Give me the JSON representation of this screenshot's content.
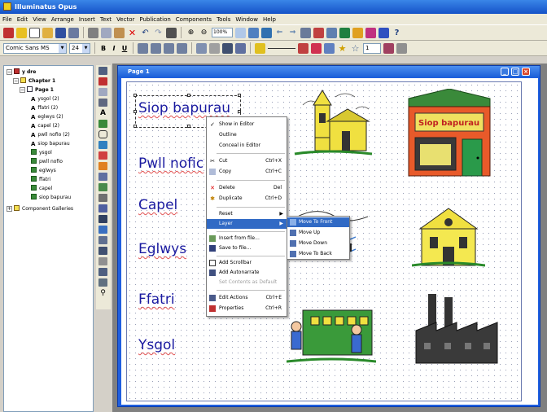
{
  "app": {
    "title": "Illuminatus Opus"
  },
  "menubar": [
    "File",
    "Edit",
    "View",
    "Arrange",
    "Insert",
    "Text",
    "Vector",
    "Publication",
    "Components",
    "Tools",
    "Window",
    "Help"
  ],
  "toolbar": {
    "zoom": "100%"
  },
  "format_bar": {
    "font": "Comic Sans MS",
    "size": "24",
    "bold": "B",
    "italic": "I",
    "underline": "U",
    "line_width": "1"
  },
  "tree": {
    "root": "y dre",
    "chapter": "Chapter 1",
    "page": "Page 1",
    "items": [
      {
        "icon": "text",
        "label": "ysgol (2)"
      },
      {
        "icon": "text",
        "label": "ffatri (2)"
      },
      {
        "icon": "text",
        "label": "eglwys (2)"
      },
      {
        "icon": "text",
        "label": "capel (2)"
      },
      {
        "icon": "text",
        "label": "pwll nofio (2)"
      },
      {
        "icon": "text",
        "label": "siop bapurau"
      },
      {
        "icon": "image",
        "label": "ysgol"
      },
      {
        "icon": "image",
        "label": "pwll nofio"
      },
      {
        "icon": "image",
        "label": "eglwys"
      },
      {
        "icon": "image",
        "label": "ffatri"
      },
      {
        "icon": "image",
        "label": "capel"
      },
      {
        "icon": "image",
        "label": "siop bapurau"
      }
    ],
    "galleries": "Component Galleries"
  },
  "document": {
    "title": "Page 1",
    "words": [
      "Siop bapurau",
      "Pwll nofic",
      "Capel",
      "Eglwys",
      "Ffatri",
      "Ysgol"
    ],
    "shop_sign": "Siop bapurau"
  },
  "context_menu": {
    "items": [
      {
        "label": "Show in Editor",
        "shortcut": "",
        "icon": "check"
      },
      {
        "label": "Outline",
        "shortcut": "",
        "icon": ""
      },
      {
        "label": "Conceal in Editor",
        "shortcut": "",
        "icon": ""
      },
      {
        "label": "Cut",
        "shortcut": "Ctrl+X",
        "icon": "scissors"
      },
      {
        "label": "Copy",
        "shortcut": "Ctrl+C",
        "icon": "copy"
      },
      {
        "label": "Delete",
        "shortcut": "Del",
        "icon": "delete"
      },
      {
        "label": "Duplicate",
        "shortcut": "Ctrl+D",
        "icon": "duplicate"
      },
      {
        "label": "Reset",
        "shortcut": "",
        "icon": "",
        "submenu": true
      },
      {
        "label": "Layer",
        "shortcut": "",
        "icon": "",
        "submenu": true
      },
      {
        "label": "Insert from file...",
        "shortcut": "",
        "icon": "insert"
      },
      {
        "label": "Save to file...",
        "shortcut": "",
        "icon": "save"
      },
      {
        "label": "Add Scrollbar",
        "shortcut": "",
        "icon": "scrollbar"
      },
      {
        "label": "Add Autonarrate",
        "shortcut": "",
        "icon": "narrate"
      },
      {
        "label": "Set Contents as Default",
        "shortcut": "",
        "icon": ""
      },
      {
        "label": "Edit Actions",
        "shortcut": "Ctrl+E",
        "icon": "actions"
      },
      {
        "label": "Properties",
        "shortcut": "Ctrl+R",
        "icon": "properties"
      }
    ]
  },
  "layer_submenu": [
    "Move To Front",
    "Move Up",
    "Move Down",
    "Move To Back"
  ],
  "colors": {
    "xp_blue": "#1f5fe0",
    "menu_highlight": "#316ac5",
    "word_blue": "#1a1aa0"
  }
}
